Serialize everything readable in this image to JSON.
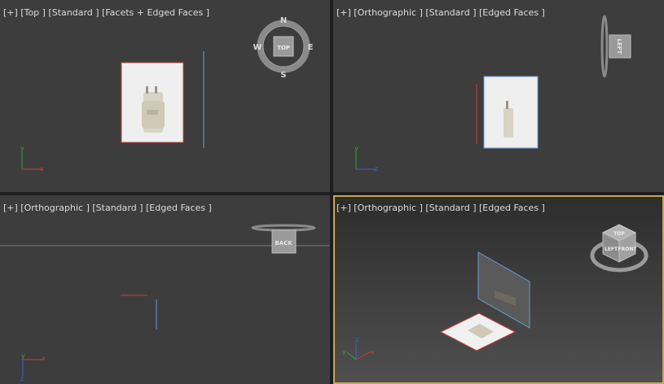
{
  "viewports": {
    "top_left": {
      "label": "[+] [Top ] [Standard ] [Facets + Edged Faces ]",
      "viewcube": {
        "n": "N",
        "s": "S",
        "e": "E",
        "w": "W",
        "face": "TOP"
      },
      "axes": {
        "y": "y",
        "x": "x"
      }
    },
    "top_right": {
      "label": "[+] [Orthographic ] [Standard ] [Edged Faces ]",
      "viewcube": {
        "face": "LEFT"
      },
      "axes": {
        "y": "y",
        "z": "z"
      }
    },
    "bottom_left": {
      "label": "[+] [Orthographic ] [Standard ] [Edged Faces ]",
      "viewcube": {
        "face": "BACK"
      },
      "axes": {
        "y": "y",
        "x": "x",
        "z": "z"
      }
    },
    "bottom_right": {
      "label": "[+] [Orthographic ] [Standard ] [Edged Faces ]",
      "viewcube": {
        "top": "TOP",
        "front": "FRONT",
        "left": "LEFT"
      },
      "axes": {
        "z": "z",
        "y": "y",
        "x": "x"
      }
    }
  },
  "colors": {
    "viewport_bg": "#3d3d3d",
    "active_border": "#c8a84b",
    "x_axis": "#d23c3c",
    "y_axis": "#3ca03c",
    "z_axis": "#3c64d2",
    "selection_red": "#c84040",
    "selection_blue": "#6a9ad8"
  },
  "icons": [
    "compass-ring-icon",
    "viewcube-icon",
    "axis-tripod-icon"
  ]
}
